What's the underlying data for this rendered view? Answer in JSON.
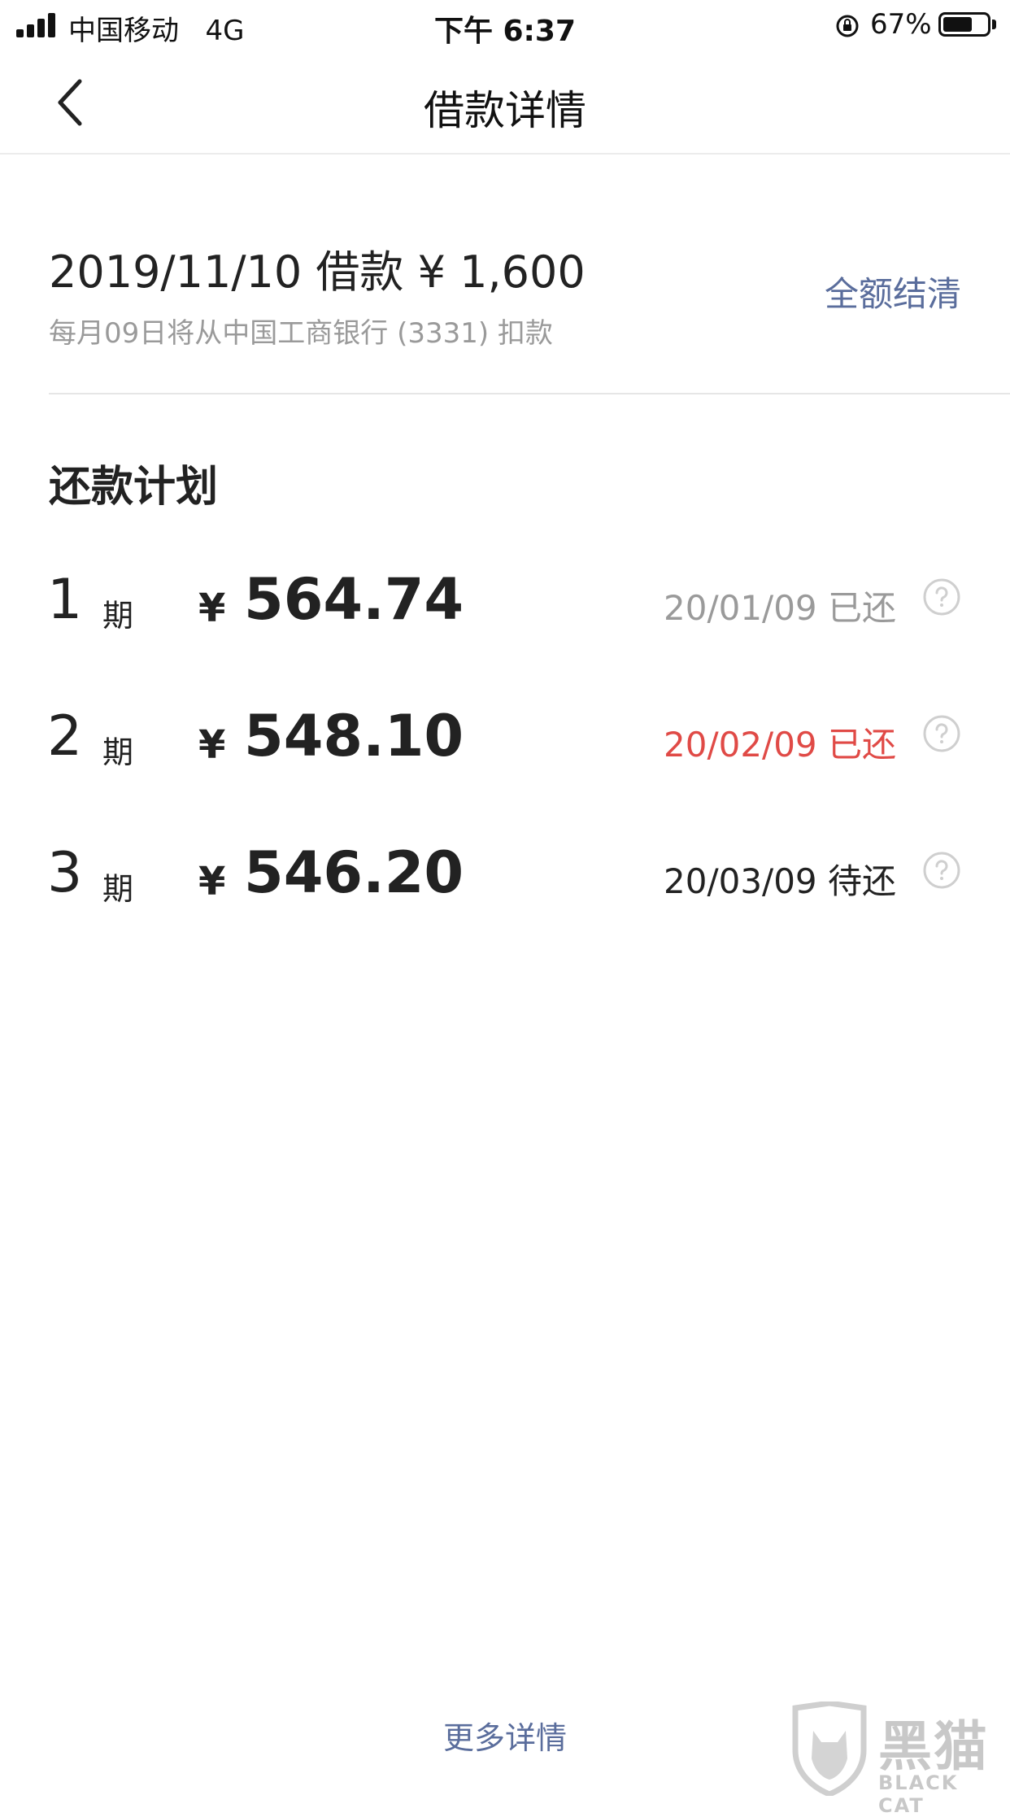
{
  "status_bar": {
    "carrier": "中国移动",
    "network": "4G",
    "time": "下午 6:37",
    "battery_percent": "67%",
    "battery_level": 0.67
  },
  "nav": {
    "title": "借款详情",
    "back_icon": "chevron-left-icon"
  },
  "loan": {
    "title": "2019/11/10 借款 ¥ 1,600",
    "subtitle": "每月09日将从中国工商银行 (3331) 扣款",
    "settle_label": "全额结清"
  },
  "plan": {
    "section_title": "还款计划",
    "installments": [
      {
        "period": "1",
        "unit": "期",
        "currency": "¥",
        "amount": "564.74",
        "status": "20/01/09 已还",
        "status_color": "#9a9a9a"
      },
      {
        "period": "2",
        "unit": "期",
        "currency": "¥",
        "amount": "548.10",
        "status": "20/02/09 已还",
        "status_color": "#e04a46"
      },
      {
        "period": "3",
        "unit": "期",
        "currency": "¥",
        "amount": "546.20",
        "status": "20/03/09 待还",
        "status_color": "#222222"
      }
    ]
  },
  "footer": {
    "more_label": "更多详情"
  },
  "watermark": {
    "text_cn": "黑猫",
    "text_en": "BLACK CAT"
  },
  "colors": {
    "accent": "#5a6d9c",
    "overdue": "#e04a46",
    "muted": "#9a9a9a"
  }
}
